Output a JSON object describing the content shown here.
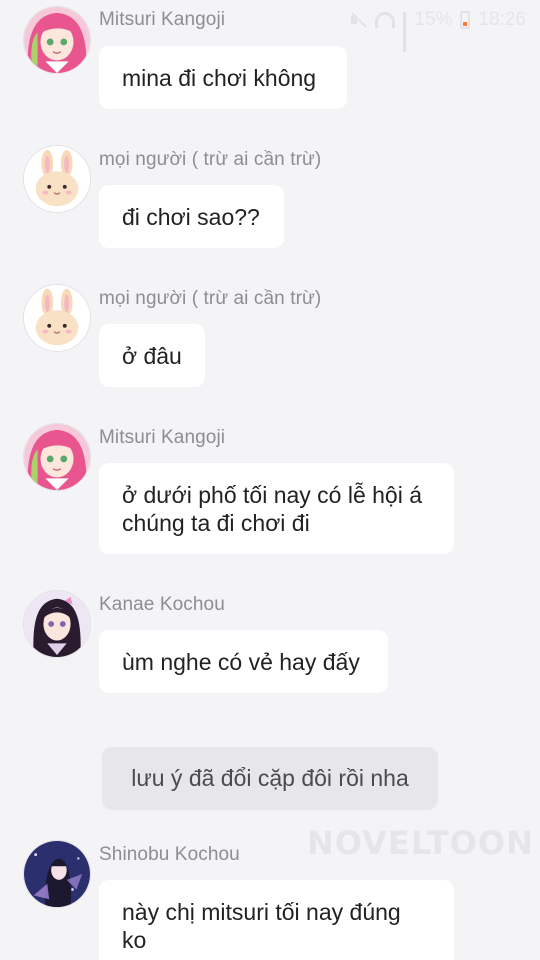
{
  "status_bar": {
    "battery": "15%",
    "time": "18:26",
    "battery_color": "#ff7a3d"
  },
  "messages": [
    {
      "sender": "Mitsuri Kangoji",
      "text": "mina đi chơi không",
      "avatar": "mitsuri-avatar"
    },
    {
      "sender": "mọi người ( trừ ai cần trừ)",
      "text": "đi chơi sao??",
      "avatar": "bunny-avatar"
    },
    {
      "sender": "mọi người ( trừ ai cần trừ)",
      "text": "ở đâu",
      "avatar": "bunny-avatar"
    },
    {
      "sender": "Mitsuri Kangoji",
      "text": "ở dưới phố tối nay có lễ hội á\nchúng ta đi chơi đi",
      "avatar": "mitsuri-avatar"
    },
    {
      "sender": "Kanae Kochou",
      "text": "ùm nghe có vẻ hay đấy",
      "avatar": "kanae-avatar"
    },
    {
      "sender": "Shinobu Kochou",
      "text": "này chị mitsuri tối nay đúng\nko",
      "avatar": "shinobu-avatar"
    }
  ],
  "notice": {
    "text": "lưu ý đã đổi cặp đôi rồi nha"
  },
  "watermark": {
    "text": "NOVELTOON"
  }
}
